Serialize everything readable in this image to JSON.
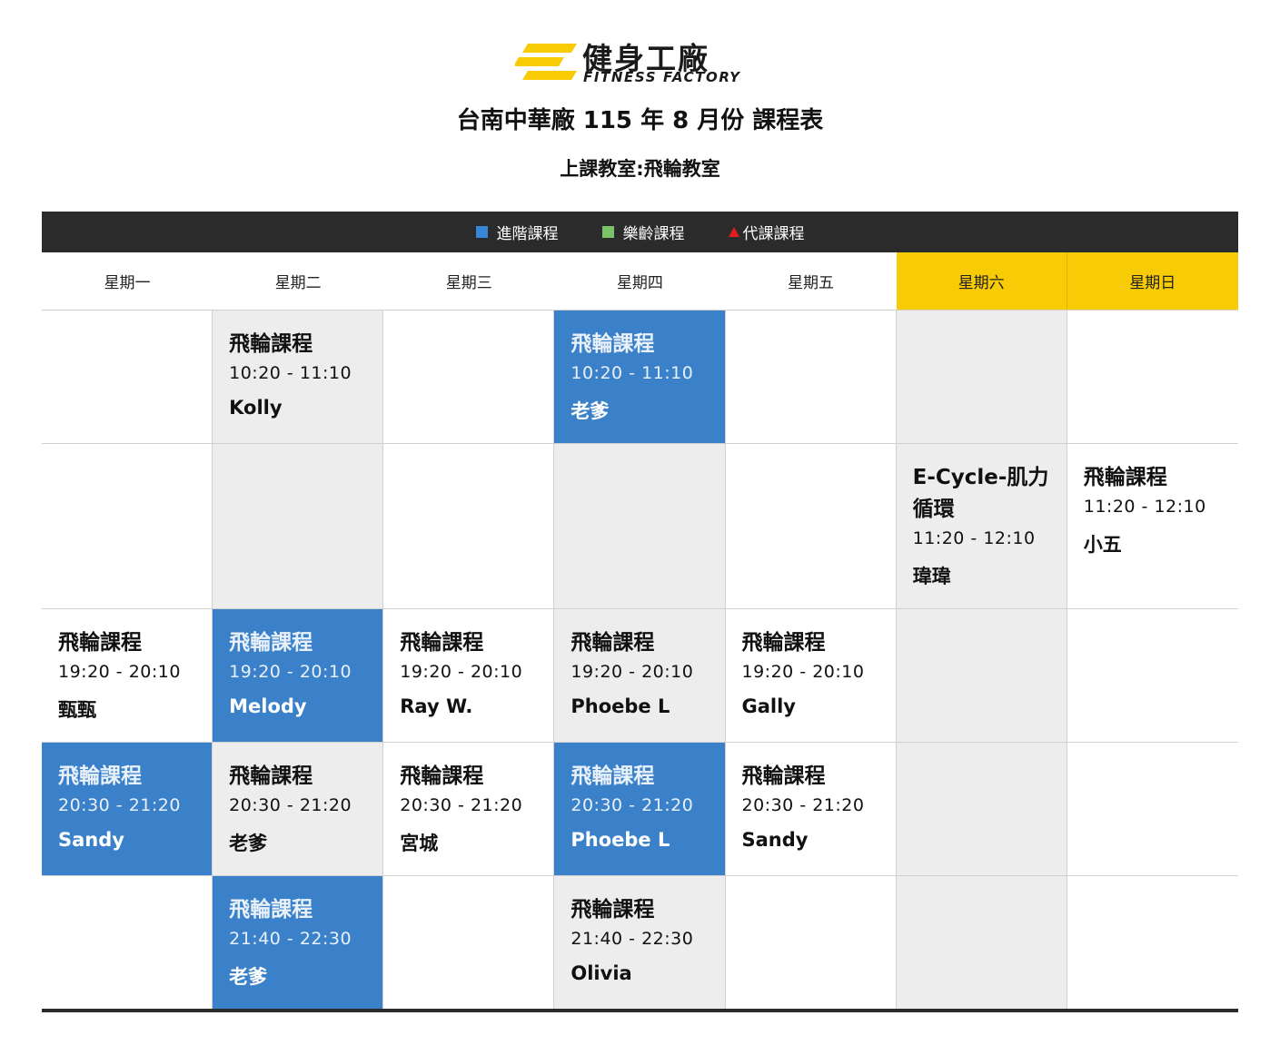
{
  "brand": {
    "name_cn": "健身工廠",
    "name_en": "FITNESS FACTORY",
    "colors": {
      "yellow": "#f7cb05",
      "dark": "#2b2b2b"
    }
  },
  "title": "台南中華廠 115 年 8 月份 課程表",
  "subtitle": "上課教室:飛輪教室",
  "legend": [
    {
      "icon": "blue-square",
      "color": "#3a86d6",
      "label": "進階課程"
    },
    {
      "icon": "green-square",
      "color": "#7cc26a",
      "label": "樂齡課程"
    },
    {
      "icon": "red-triangle",
      "color": "#e21d1d",
      "label": "代課課程"
    }
  ],
  "days": [
    "星期一",
    "星期二",
    "星期三",
    "星期四",
    "星期五",
    "星期六",
    "星期日"
  ],
  "rows": [
    [
      null,
      {
        "name": "飛輪課程",
        "time": "10:20 - 11:10",
        "coach": "Kolly"
      },
      null,
      {
        "name": "飛輪課程",
        "time": "10:20 - 11:10",
        "coach": "老爹"
      },
      null,
      null,
      null
    ],
    [
      null,
      null,
      null,
      null,
      null,
      {
        "name": "E-Cycle-肌力循環",
        "time": "11:20 - 12:10",
        "coach": "瑋瑋"
      },
      {
        "name": "飛輪課程",
        "time": "11:20 - 12:10",
        "coach": "小五"
      }
    ],
    [
      {
        "name": "飛輪課程",
        "time": "19:20 - 20:10",
        "coach": "甄甄"
      },
      {
        "name": "飛輪課程",
        "time": "19:20 - 20:10",
        "coach": "Melody"
      },
      {
        "name": "飛輪課程",
        "time": "19:20 - 20:10",
        "coach": "Ray W."
      },
      {
        "name": "飛輪課程",
        "time": "19:20 - 20:10",
        "coach": "Phoebe L"
      },
      {
        "name": "飛輪課程",
        "time": "19:20 - 20:10",
        "coach": "Gally"
      },
      null,
      null
    ],
    [
      {
        "name": "飛輪課程",
        "time": "20:30 - 21:20",
        "coach": "Sandy"
      },
      {
        "name": "飛輪課程",
        "time": "20:30 - 21:20",
        "coach": "老爹"
      },
      {
        "name": "飛輪課程",
        "time": "20:30 - 21:20",
        "coach": "宮城"
      },
      {
        "name": "飛輪課程",
        "time": "20:30 - 21:20",
        "coach": "Phoebe L"
      },
      {
        "name": "飛輪課程",
        "time": "20:30 - 21:20",
        "coach": "Sandy"
      },
      null,
      null
    ],
    [
      null,
      {
        "name": "飛輪課程",
        "time": "21:40 - 22:30",
        "coach": "老爹"
      },
      null,
      {
        "name": "飛輪課程",
        "time": "21:40 - 22:30",
        "coach": "Olivia"
      },
      null,
      null,
      null
    ]
  ]
}
